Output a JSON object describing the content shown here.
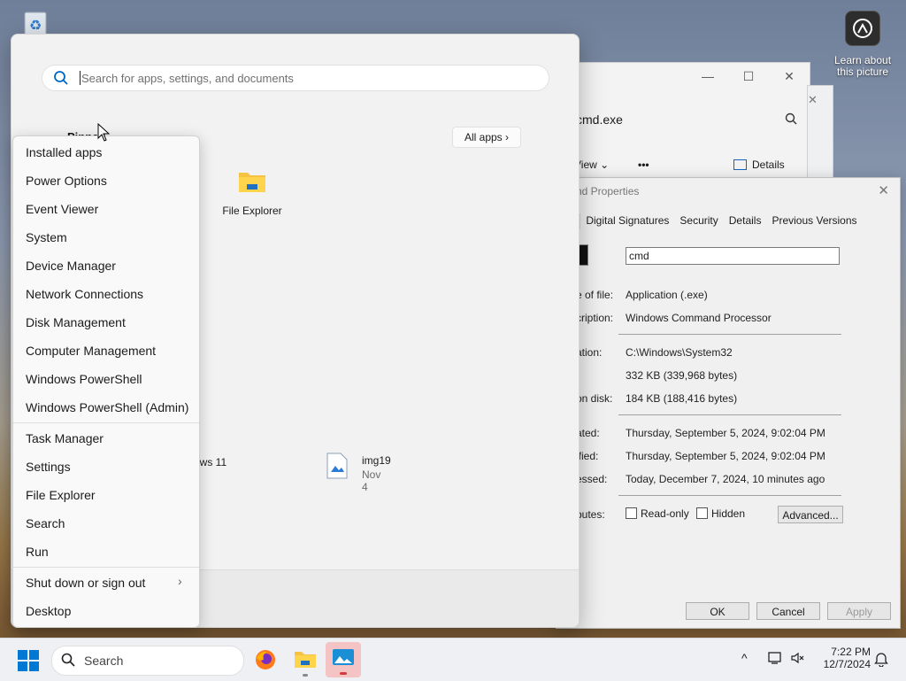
{
  "desktop": {
    "learn_label": "Learn about this picture"
  },
  "explorer": {
    "address": "cmd.exe",
    "view_label": "View",
    "more_label": "•••",
    "details_label": "Details"
  },
  "properties": {
    "title": "nd Properties",
    "tabs": [
      "ral",
      "Digital Signatures",
      "Security",
      "Details",
      "Previous Versions"
    ],
    "name_value": "cmd",
    "rows": {
      "type_label": "e of file:",
      "type_value": "Application (.exe)",
      "desc_label": "cription:",
      "desc_value": "Windows Command Processor",
      "location_label": "ation:",
      "location_value": "C:\\Windows\\System32",
      "size_label": ":",
      "size_value": "332 KB (339,968 bytes)",
      "size_disk_label": "on disk:",
      "size_disk_value": "184 KB (188,416 bytes)",
      "created_label": "ated:",
      "created_value": "Thursday, September 5, 2024, 9:02:04 PM",
      "modified_label": "ified:",
      "modified_value": "Thursday, September 5, 2024, 9:02:04 PM",
      "accessed_label": "essed:",
      "accessed_value": "Today, December 7, 2024, 10 minutes ago",
      "attributes_label": "butes:",
      "readonly_label": "Read-only",
      "hidden_label": "Hidden",
      "advanced_label": "Advanced..."
    },
    "buttons": {
      "ok": "OK",
      "cancel": "Cancel",
      "apply": "Apply"
    }
  },
  "start_menu": {
    "search_placeholder": "Search for apps, settings, and documents",
    "pinned_label": "Pinned",
    "all_apps_label": "All apps",
    "pinned_apps": [
      {
        "label": "File Explorer",
        "icon": "folder-icon"
      }
    ],
    "recommended": [
      {
        "title": "ows 11",
        "subtitle": ""
      },
      {
        "title": "img19",
        "subtitle": "Nov 4",
        "icon": "image-file-icon"
      }
    ]
  },
  "context_menu": {
    "items": [
      "Installed apps",
      "Power Options",
      "Event Viewer",
      "System",
      "Device Manager",
      "Network Connections",
      "Disk Management",
      "Computer Management",
      "Windows PowerShell",
      "Windows PowerShell (Admin)",
      "Task Manager",
      "Settings",
      "File Explorer",
      "Search",
      "Run",
      "Shut down or sign out",
      "Desktop"
    ]
  },
  "taskbar": {
    "search_label": "Search",
    "time": "7:22 PM",
    "date": "12/7/2024"
  },
  "colors": {
    "accent": "#0067c0",
    "folder": "#f5c242"
  }
}
